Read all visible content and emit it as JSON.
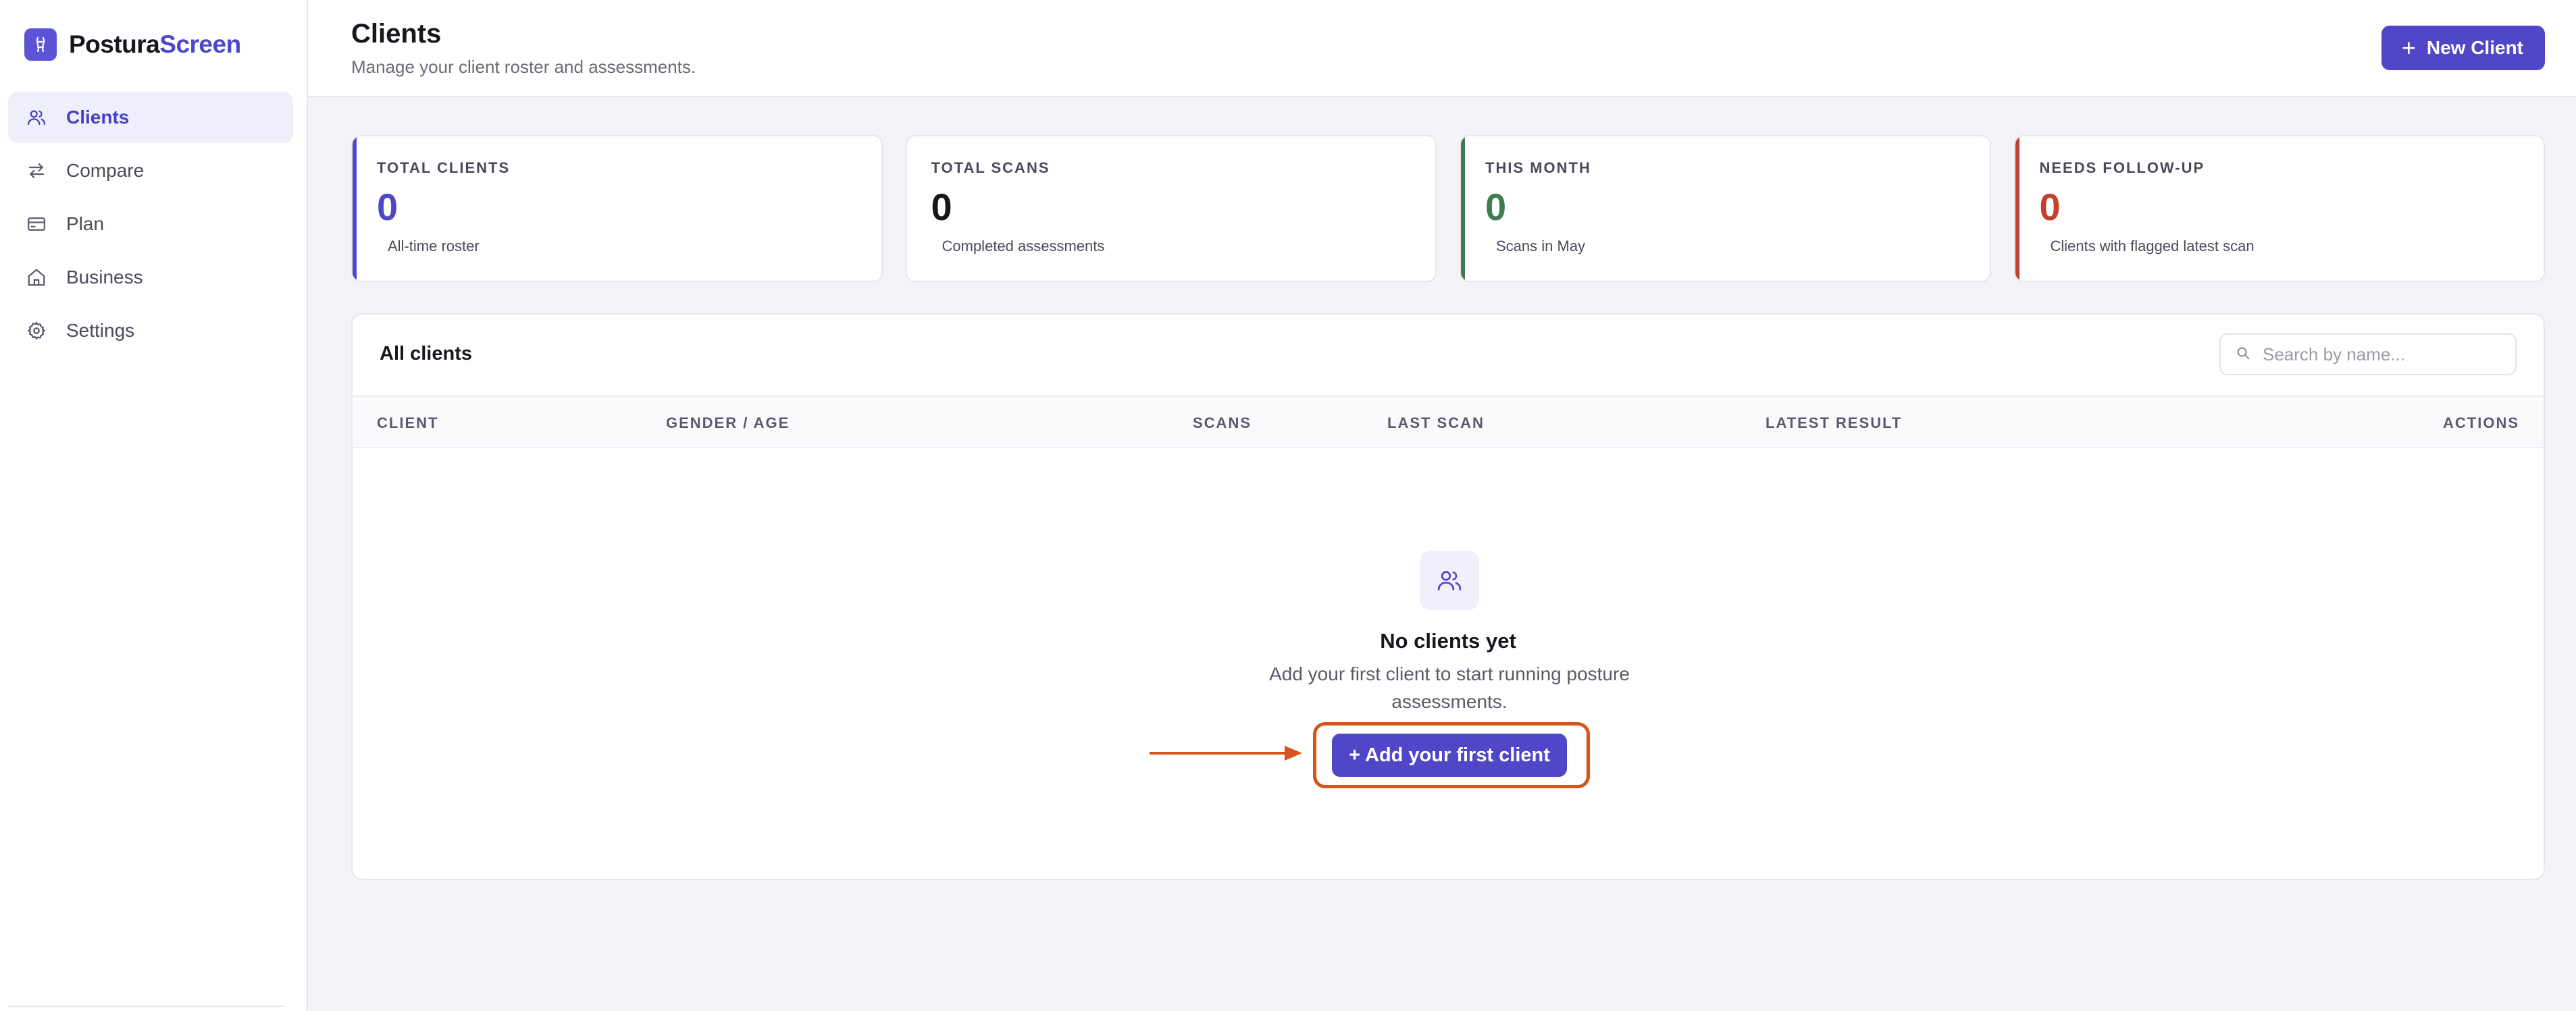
{
  "brand": {
    "name_part1": "Postura",
    "name_part2": "Screen"
  },
  "sidebar": {
    "items": [
      {
        "label": "Clients",
        "icon": "users-icon",
        "active": true
      },
      {
        "label": "Compare",
        "icon": "swap-arrows-icon"
      },
      {
        "label": "Plan",
        "icon": "card-icon"
      },
      {
        "label": "Business",
        "icon": "home-icon"
      },
      {
        "label": "Settings",
        "icon": "gear-icon"
      }
    ]
  },
  "header": {
    "title": "Clients",
    "subtitle": "Manage your client roster and assessments.",
    "new_client_label": "New Client"
  },
  "stats": [
    {
      "label": "TOTAL CLIENTS",
      "value": "0",
      "caption": "All-time roster",
      "color": "#4f46c8"
    },
    {
      "label": "TOTAL SCANS",
      "value": "0",
      "caption": "Completed assessments",
      "color": "#16161d"
    },
    {
      "label": "THIS MONTH",
      "value": "0",
      "caption": "Scans in May",
      "color": "#3f7d4e"
    },
    {
      "label": "NEEDS FOLLOW-UP",
      "value": "0",
      "caption": "Clients with flagged latest scan",
      "color": "#c2402e"
    }
  ],
  "panel": {
    "title": "All clients",
    "search_placeholder": "Search by name...",
    "columns": [
      "CLIENT",
      "GENDER / AGE",
      "SCANS",
      "LAST SCAN",
      "LATEST RESULT",
      "ACTIONS"
    ],
    "empty_title": "No clients yet",
    "empty_text": "Add your first client to start running posture assessments.",
    "add_first_label": "+ Add your first client"
  },
  "colors": {
    "accent": "#4f46c8",
    "highlight": "#d4541c",
    "success": "#3f7d4e",
    "danger": "#c2402e"
  }
}
